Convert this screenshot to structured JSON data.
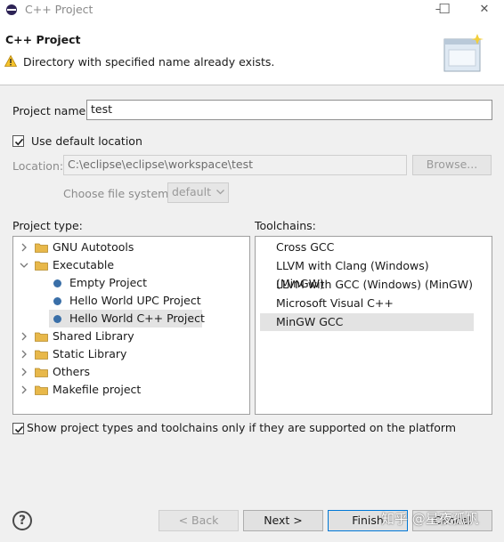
{
  "window": {
    "title": "C++ Project",
    "minimize_glyph": "–",
    "maximize_glyph": "☐",
    "close_glyph": "✕"
  },
  "banner": {
    "title": "C++ Project",
    "message": "Directory with specified name already exists.",
    "message_icon": "warning-icon"
  },
  "form": {
    "project_name_label": "Project name:",
    "project_name_value": "test",
    "use_default_location_label": "Use default location",
    "use_default_location_checked": true,
    "location_label": "Location:",
    "location_value": "C:\\eclipse\\eclipse\\workspace\\test",
    "browse_label": "Browse...",
    "file_system_label": "Choose file system:",
    "file_system_value": "default"
  },
  "project_type": {
    "label": "Project type:",
    "items": [
      {
        "label": "GNU Autotools",
        "level": 0,
        "kind": "folder",
        "expanded": false
      },
      {
        "label": "Executable",
        "level": 0,
        "kind": "folder",
        "expanded": true
      },
      {
        "label": "Empty Project",
        "level": 1,
        "kind": "leaf"
      },
      {
        "label": "Hello World UPC Project",
        "level": 1,
        "kind": "leaf"
      },
      {
        "label": "Hello World C++ Project",
        "level": 1,
        "kind": "leaf",
        "selected": true
      },
      {
        "label": "Shared Library",
        "level": 0,
        "kind": "folder",
        "expanded": false
      },
      {
        "label": "Static Library",
        "level": 0,
        "kind": "folder",
        "expanded": false
      },
      {
        "label": "Others",
        "level": 0,
        "kind": "folder",
        "expanded": false
      },
      {
        "label": "Makefile project",
        "level": 0,
        "kind": "folder",
        "expanded": false
      }
    ]
  },
  "toolchains": {
    "label": "Toolchains:",
    "items": [
      {
        "label": "Cross GCC"
      },
      {
        "label": "LLVM with Clang (Windows) (MinGW)"
      },
      {
        "label": "LLVM with GCC (Windows) (MinGW)"
      },
      {
        "label": "Microsoft Visual C++"
      },
      {
        "label": "MinGW GCC",
        "selected": true
      }
    ]
  },
  "filter": {
    "label": "Show project types and toolchains only if they are supported on the platform",
    "checked": true
  },
  "footer": {
    "help_glyph": "?",
    "back_label": "< Back",
    "next_label": "Next >",
    "finish_label": "Finish",
    "cancel_label": "Cancel",
    "watermark": "知乎 @星夜孤帆"
  },
  "colors": {
    "accent": "#0078d7",
    "selection": "#e3e3e3",
    "folder": "#e8b84a",
    "leaf_bullet": "#3a6fa8"
  }
}
